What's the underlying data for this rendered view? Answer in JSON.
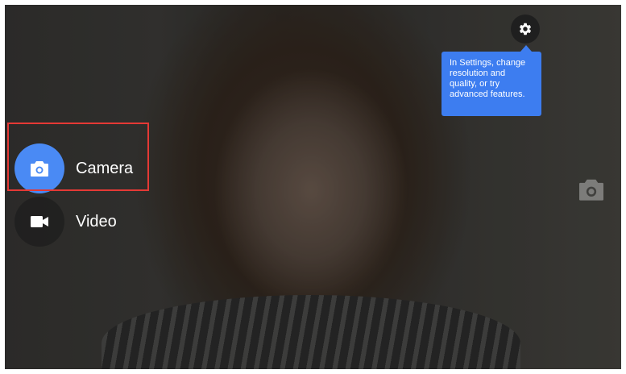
{
  "modes": [
    {
      "label": "Camera",
      "icon": "camera-icon",
      "active": true
    },
    {
      "label": "Video",
      "icon": "videocam-icon",
      "active": false
    }
  ],
  "settings": {
    "icon": "gear-icon",
    "tooltip": "In Settings, change resolution and quality, or try advanced features."
  },
  "colors": {
    "accent": "#4a8af4",
    "tooltip_bg": "#3d7df0",
    "highlight": "#e53935"
  }
}
